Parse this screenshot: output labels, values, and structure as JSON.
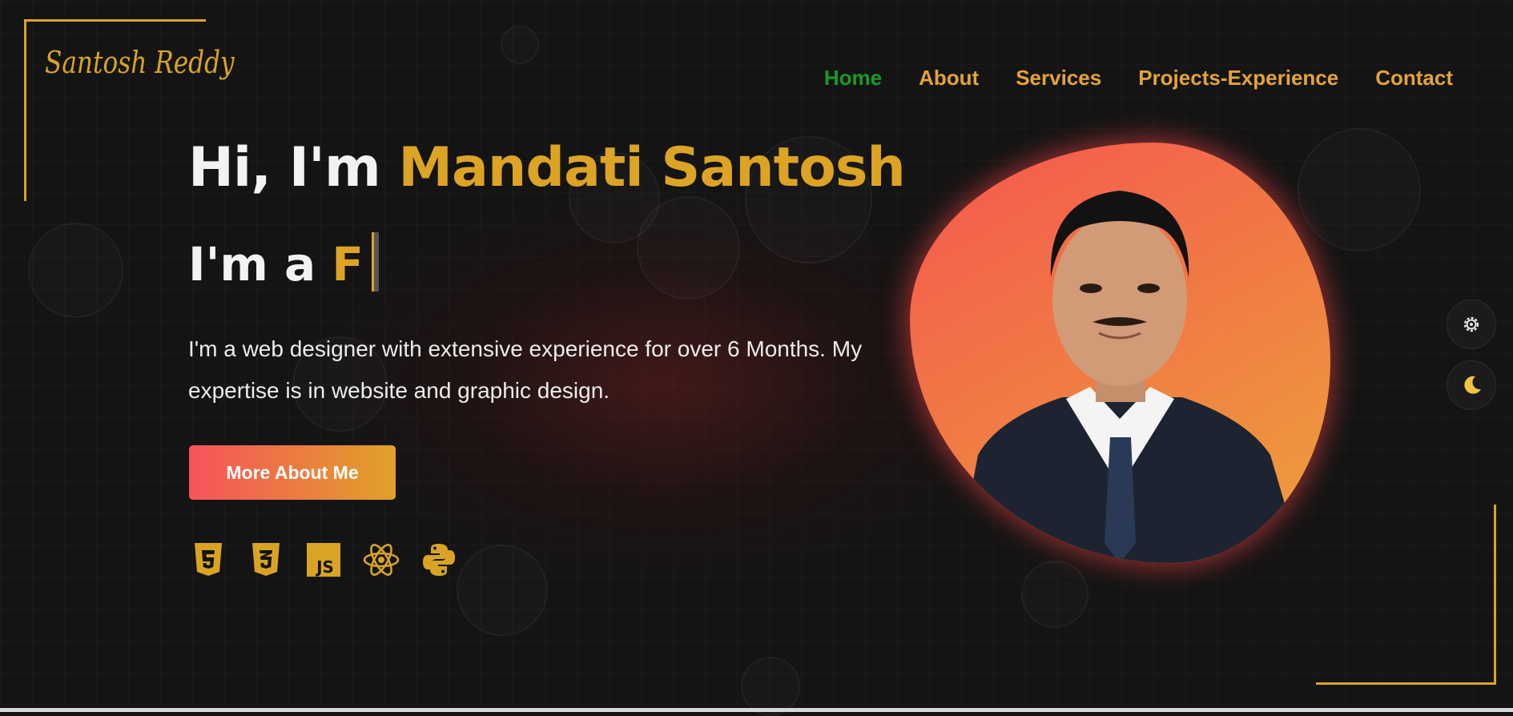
{
  "brand": {
    "logo_text": "Santosh Reddy",
    "accent": "#d9a424"
  },
  "nav": {
    "items": [
      {
        "label": "Home",
        "active": true
      },
      {
        "label": "About",
        "active": false
      },
      {
        "label": "Services",
        "active": false
      },
      {
        "label": "Projects-Experience",
        "active": false
      },
      {
        "label": "Contact",
        "active": false
      }
    ],
    "active_color": "#1a9a22",
    "link_color": "#e3a33a"
  },
  "hero": {
    "greeting": "Hi, I'm ",
    "name": "Mandati Santosh",
    "role_prefix": "I'm a ",
    "role_typed": "F",
    "description": "I'm a web designer with extensive experience for over 6 Months. My expertise is in website and graphic design.",
    "cta_label": "More About Me"
  },
  "skills": {
    "icons": [
      "html5-icon",
      "css3-icon",
      "javascript-icon",
      "react-icon",
      "python-icon"
    ],
    "js_text": "JS"
  },
  "side_controls": {
    "settings_icon": "gear-icon",
    "theme_icon": "moon-icon"
  },
  "colors": {
    "background": "#141414",
    "cta_start": "#f7535c",
    "cta_end": "#e1a128"
  }
}
